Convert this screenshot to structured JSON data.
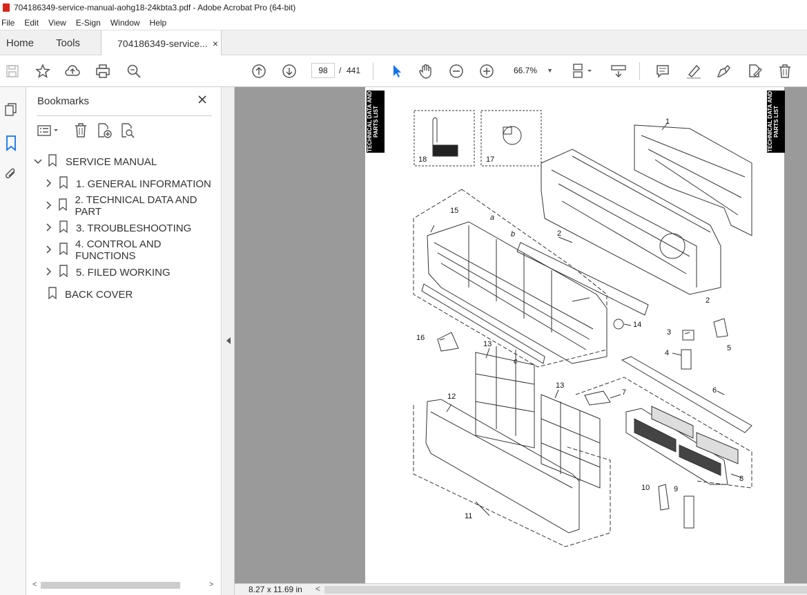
{
  "window": {
    "title": "704186349-service-manual-aohg18-24kbta3.pdf - Adobe Acrobat Pro (64-bit)"
  },
  "menu": [
    "File",
    "Edit",
    "View",
    "E-Sign",
    "Window",
    "Help"
  ],
  "tabs": {
    "home": "Home",
    "tools": "Tools",
    "document": "704186349-service...",
    "close": "×"
  },
  "toolbar": {
    "page_current": "98",
    "page_sep": "/",
    "page_total": "441",
    "zoom": "66.7%"
  },
  "bookmarks": {
    "title": "Bookmarks",
    "items": [
      {
        "label": "SERVICE MANUAL",
        "expand": "down"
      },
      {
        "label": "1. GENERAL INFORMATION",
        "expand": "right"
      },
      {
        "label": "2. TECHNICAL DATA AND PART",
        "expand": "right"
      },
      {
        "label": "3. TROUBLESHOOTING",
        "expand": "right"
      },
      {
        "label": "4. CONTROL AND FUNCTIONS",
        "expand": "right"
      },
      {
        "label": "5. FILED WORKING",
        "expand": "right"
      },
      {
        "label": "BACK COVER",
        "expand": "none"
      }
    ]
  },
  "page": {
    "side_tab": "TECHNICAL DATA AND PARTS LIST",
    "callouts": [
      "1",
      "2",
      "2",
      "3",
      "4",
      "5",
      "6",
      "7",
      "8",
      "9",
      "10",
      "11",
      "12",
      "13",
      "13",
      "14",
      "15",
      "16",
      "17",
      "18",
      "a",
      "b",
      "c"
    ]
  },
  "status": {
    "page_size": "8.27 x 11.69 in"
  },
  "colors": {
    "accent": "#1473e6",
    "pdf_red": "#d8251b",
    "doc_bg": "#9a9a9a"
  }
}
